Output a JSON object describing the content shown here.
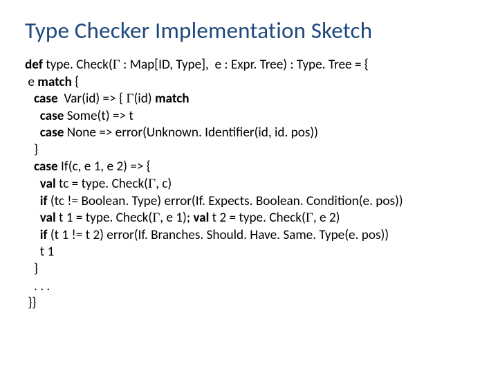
{
  "title": "Type Checker Implementation Sketch",
  "gamma": "Γ",
  "code": {
    "l1a": "def",
    "l1b": " type. Check(",
    "l1c": " : Map[ID, Type],  e : Expr. Tree) : Type. Tree = {",
    "l2a": " e ",
    "l2b": "match",
    "l2c": " {",
    "l3a": "   ",
    "l3b": "case",
    "l3c": "  Var(id) => { ",
    "l3d": "(id) ",
    "l3e": "match",
    "l4a": "     ",
    "l4b": "case",
    "l4c": " Some(t) => t",
    "l5a": "     ",
    "l5b": "case",
    "l5c": " None => error(Unknown. Identifier(id, id. pos))",
    "l6": "   }",
    "l7a": "   ",
    "l7b": "case",
    "l7c": " If(c, e 1, e 2) => { ",
    "l8a": "     ",
    "l8b": "val",
    "l8c": " tc = type. Check(",
    "l8d": ", c)",
    "l9a": "     ",
    "l9b": "if",
    "l9c": " (tc != Boolean. Type) error(If. Expects. Boolean. Condition(e. pos))",
    "l10a": "     ",
    "l10b": "val",
    "l10c": " t 1 = type. Check(",
    "l10d": ", e 1); ",
    "l10e": "val",
    "l10f": " t 2 = type. Check(",
    "l10g": ", e 2)",
    "l11a": "     ",
    "l11b": "if",
    "l11c": " (t 1 != t 2) error(If. Branches. Should. Have. Same. Type(e. pos))",
    "l12": "     t 1",
    "l13": "   }",
    "l14": "   . . .",
    "l15": " }}"
  }
}
